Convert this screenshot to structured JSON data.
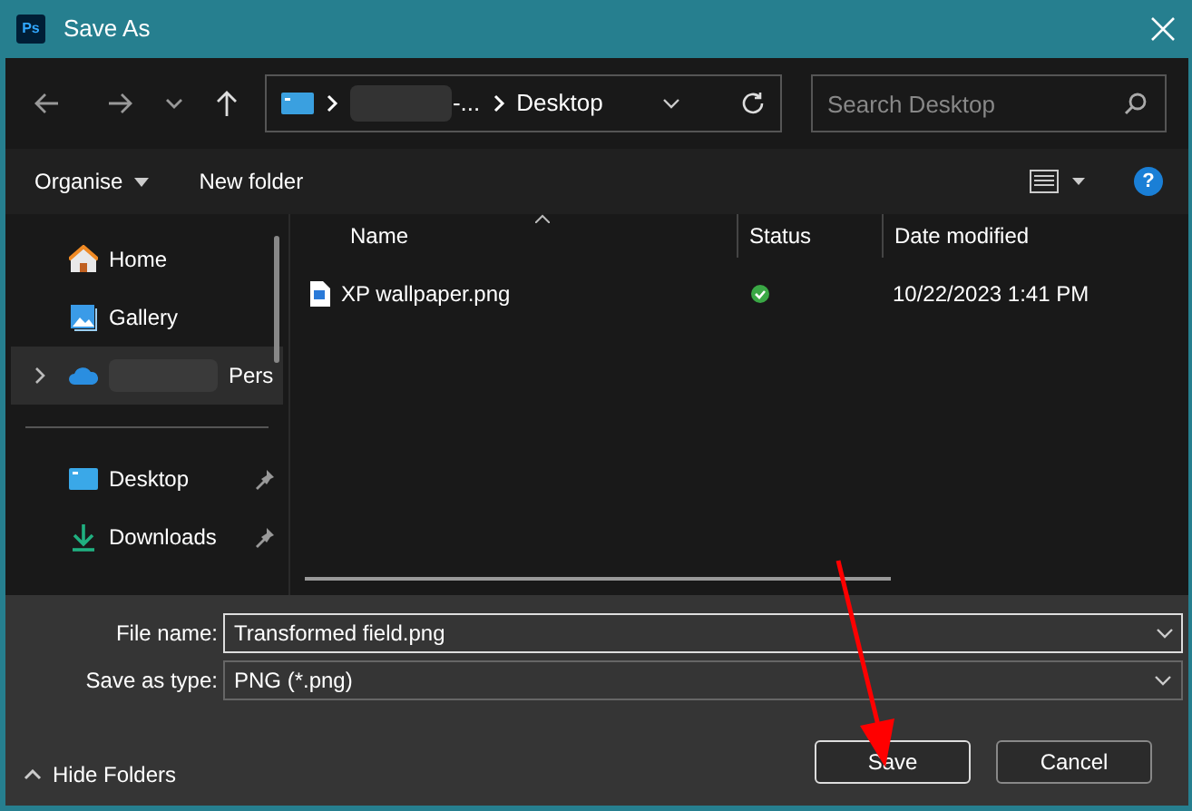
{
  "window": {
    "title": "Save As",
    "app_icon_text": "Ps",
    "help_text": "?"
  },
  "address_bar": {
    "segments": [
      {
        "kind": "redacted",
        "text": "-..."
      },
      {
        "kind": "folder",
        "text": "Desktop"
      }
    ]
  },
  "search": {
    "placeholder": "Search Desktop"
  },
  "toolbar": {
    "organise": "Organise",
    "new_folder": "New folder"
  },
  "sidebar": {
    "items": [
      {
        "kind": "home",
        "label": "Home",
        "selected": false,
        "pinned": false,
        "expandable": false
      },
      {
        "kind": "gallery",
        "label": "Gallery",
        "selected": false,
        "pinned": false,
        "expandable": false
      },
      {
        "kind": "cloud",
        "label": "Pers",
        "selected": true,
        "pinned": false,
        "expandable": true,
        "redacted": true
      },
      {
        "kind": "divider"
      },
      {
        "kind": "desktop",
        "label": "Desktop",
        "selected": false,
        "pinned": true,
        "expandable": false
      },
      {
        "kind": "downloads",
        "label": "Downloads",
        "selected": false,
        "pinned": true,
        "expandable": false
      }
    ]
  },
  "table": {
    "columns": [
      "Name",
      "Status",
      "Date modified"
    ],
    "rows": [
      {
        "name": "XP wallpaper.png",
        "synced": true,
        "date": "10/22/2023 1:41 PM"
      }
    ]
  },
  "form": {
    "file_name_label": "File name:",
    "file_name": "Transformed field.png",
    "type_label": "Save as type:",
    "type": "PNG (*.png)"
  },
  "footer": {
    "hide_folders": "Hide Folders",
    "buttons": [
      "Save",
      "Cancel"
    ]
  }
}
